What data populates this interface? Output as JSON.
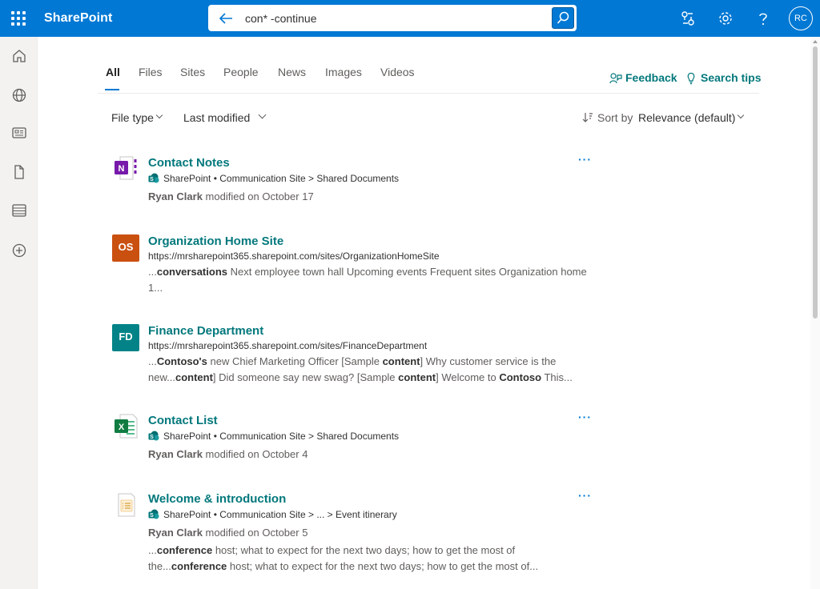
{
  "app": {
    "name": "SharePoint"
  },
  "search": {
    "query": "con* -continue"
  },
  "user": {
    "initials": "RC"
  },
  "tabs": [
    {
      "label": "All"
    },
    {
      "label": "Files"
    },
    {
      "label": "Sites"
    },
    {
      "label": "People"
    },
    {
      "label": "News"
    },
    {
      "label": "Images"
    },
    {
      "label": "Videos"
    }
  ],
  "actions": {
    "feedback": "Feedback",
    "search_tips": "Search tips"
  },
  "filters": {
    "file_type": "File type",
    "last_modified": "Last modified",
    "sort_by": "Sort by",
    "sort_value": "Relevance (default)"
  },
  "results": [
    {
      "title": "Contact Notes",
      "path": [
        "SharePoint",
        "Communication Site",
        "Shared Documents"
      ],
      "author": "Ryan Clark",
      "modified_text": " modified on October 17",
      "more": "···",
      "icon": "onenote-icon"
    },
    {
      "title": "Organization Home Site",
      "url": "https://mrsharepoint365.sharepoint.com/sites/OrganizationHomeSite",
      "tile": "OS",
      "tile_color": "#ca5010",
      "snippet": [
        {
          "t": "...",
          "b": false
        },
        {
          "t": "conversations",
          "b": true
        },
        {
          "t": " Next employee town hall Upcoming events Frequent sites Organization home 1...",
          "b": false
        }
      ]
    },
    {
      "title": "Finance Department",
      "url": "https://mrsharepoint365.sharepoint.com/sites/FinanceDepartment",
      "tile": "FD",
      "tile_color": "#038387",
      "snippet": [
        {
          "t": "...",
          "b": false
        },
        {
          "t": "Contoso's",
          "b": true
        },
        {
          "t": " new Chief Marketing Officer [Sample ",
          "b": false
        },
        {
          "t": "content",
          "b": true
        },
        {
          "t": "] Why customer service is the new...",
          "b": false
        },
        {
          "t": "content",
          "b": true
        },
        {
          "t": "] Did someone say new swag? [Sample ",
          "b": false
        },
        {
          "t": "content",
          "b": true
        },
        {
          "t": "] Welcome to ",
          "b": false
        },
        {
          "t": "Contoso",
          "b": true
        },
        {
          "t": " This...",
          "b": false
        }
      ]
    },
    {
      "title": "Contact List",
      "path": [
        "SharePoint",
        "Communication Site",
        "Shared Documents"
      ],
      "author": "Ryan Clark",
      "modified_text": " modified on October 4",
      "more": "···",
      "icon": "excel-icon"
    },
    {
      "title": "Welcome & introduction",
      "path": [
        "SharePoint",
        "Communication Site",
        "...",
        "Event itinerary"
      ],
      "author": "Ryan Clark",
      "modified_text": " modified on October 5",
      "more": "···",
      "icon": "list-document-icon",
      "snippet": [
        {
          "t": "...",
          "b": false
        },
        {
          "t": "conference",
          "b": true
        },
        {
          "t": " host; what to expect for the next two days; how to get the most of the...",
          "b": false
        },
        {
          "t": "conference",
          "b": true
        },
        {
          "t": " host; what to expect for the next two days; how to get the most of...",
          "b": false
        }
      ]
    }
  ],
  "colors": {
    "brand": "#0078d4",
    "link": "#03787c"
  }
}
